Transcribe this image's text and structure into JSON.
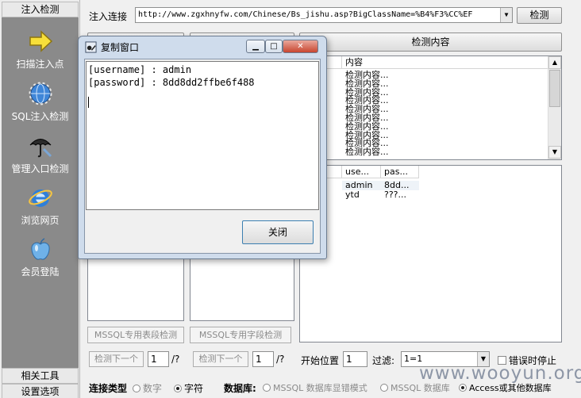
{
  "sidebar": {
    "header": "注入检测",
    "items": [
      {
        "label": "扫描注入点",
        "icon": "yellow-arrow-icon"
      },
      {
        "label": "SQL注入检测",
        "icon": "sql-injection-globe-icon"
      },
      {
        "label": "管理入口检测",
        "icon": "umbrella-icon"
      },
      {
        "label": "浏览网页",
        "icon": "internet-explorer-icon"
      },
      {
        "label": "会员登陆",
        "icon": "apple-icon"
      }
    ],
    "footer_tools": "相关工具",
    "footer_settings": "设置选项"
  },
  "toolbar": {
    "url_label": "注入连接",
    "url_value": "http://www.zgxhnyfw.com/Chinese/Bs_jishu.asp?BigClassName=%B4%F3%CC%EF",
    "detect_button": "检测"
  },
  "content_panel": {
    "button": "检测内容",
    "header": "内容",
    "rows": [
      "检测内容...",
      "检测内容...",
      "检测内容...",
      "检测内容...",
      "检测内容...",
      "检测内容...",
      "检测内容...",
      "检测内容...",
      "检测内容...",
      "检测内容..."
    ]
  },
  "data_table": {
    "columns": [
      "use...",
      "pas..."
    ],
    "rows": [
      [
        "admin",
        "8dd..."
      ],
      [
        "ytd",
        "???..."
      ]
    ]
  },
  "left_panels": {
    "tables_button": "MSSQL专用表段检测",
    "fields_button": "MSSQL专用字段检测"
  },
  "pager": {
    "next_label": "检测下一个",
    "page1": "1",
    "total1": "/?",
    "page2": "1",
    "total2": "/?",
    "start_label": "开始位置",
    "start_value": "1",
    "filter_label": "过滤:",
    "filter_value": "1=1",
    "stop_on_error": "错误时停止"
  },
  "bottom": {
    "conn_type_label": "连接类型",
    "opt_number": "数字",
    "opt_char": "字符",
    "db_label": "数据库:",
    "opt_mssql_error": "MSSQL 数据库显错模式",
    "opt_mssql_db": "MSSQL 数据库",
    "opt_access": "Access或其他数据库"
  },
  "dialog": {
    "title": "复制窗口",
    "lines": [
      "[username] : admin",
      "[password] : 8dd8dd2ffbe6f488"
    ],
    "close_button": "关闭"
  },
  "watermark": "www.wooyun.org"
}
